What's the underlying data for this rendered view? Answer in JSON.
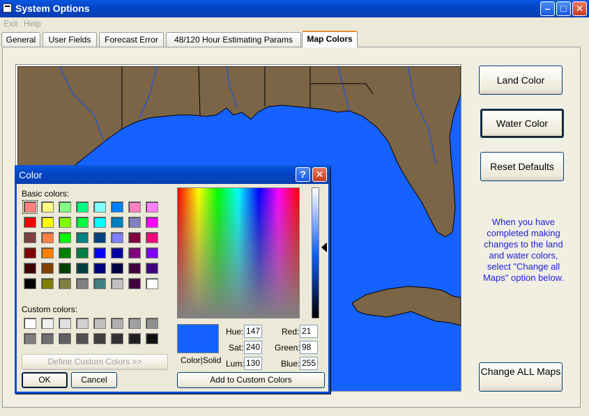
{
  "window": {
    "title": "System Options"
  },
  "menu": {
    "items": [
      "Exit",
      "Help"
    ]
  },
  "tabs": [
    {
      "label": "General"
    },
    {
      "label": "User Fields"
    },
    {
      "label": "Forecast Error"
    },
    {
      "label": "48/120 Hour Estimating Params"
    },
    {
      "label": "Map Colors",
      "active": true
    }
  ],
  "buttons": {
    "land": {
      "label": "Land Color",
      "accel": "L"
    },
    "water": {
      "label": "Water Color",
      "accel": "W"
    },
    "reset": {
      "label": "Reset Defaults",
      "accel": "R"
    },
    "change_all": {
      "label": "Change ALL Maps"
    }
  },
  "info_text": "When you have completed making changes to the land and water colors, select \"Change all Maps\" option below.",
  "map_colors": {
    "land": "#7c6447",
    "water": "#1562ff"
  },
  "color_dialog": {
    "title": "Color",
    "basic_colors_label": "Basic colors:",
    "custom_colors_label": "Custom colors:",
    "basic_colors": [
      [
        "#ff8080",
        "#ffff80",
        "#80ff80",
        "#00ff80",
        "#80ffff",
        "#0080ff",
        "#ff80c0",
        "#ff80ff"
      ],
      [
        "#ff0000",
        "#ffff00",
        "#80ff00",
        "#00ff40",
        "#00ffff",
        "#0080c0",
        "#8080c0",
        "#ff00ff"
      ],
      [
        "#804040",
        "#ff8040",
        "#00ff00",
        "#008080",
        "#004080",
        "#8080ff",
        "#800040",
        "#ff0080"
      ],
      [
        "#800000",
        "#ff8000",
        "#008000",
        "#008040",
        "#0000ff",
        "#0000a0",
        "#800080",
        "#8000ff"
      ],
      [
        "#400000",
        "#804000",
        "#004000",
        "#004040",
        "#000080",
        "#000040",
        "#400040",
        "#400080"
      ],
      [
        "#000000",
        "#808000",
        "#808040",
        "#808080",
        "#408080",
        "#c0c0c0",
        "#400040",
        "#ffffff"
      ]
    ],
    "custom_colors": [
      [
        "#ffffff",
        "#f0f0f0",
        "#e0e0e0",
        "#d0d0d0",
        "#c0c0c0",
        "#b0b0b0",
        "#a0a0a0",
        "#909090"
      ],
      [
        "#808080",
        "#707070",
        "#606060",
        "#505050",
        "#404040",
        "#303030",
        "#202020",
        "#101010"
      ]
    ],
    "define_custom_label": "Define Custom Colors >>",
    "ok_label": "OK",
    "cancel_label": "Cancel",
    "color_solid_label": "Color|Solid",
    "add_custom_label": "Add to Custom Colors",
    "hue_label": "Hue:",
    "hue": "147",
    "sat_label": "Sat:",
    "sat": "240",
    "lum_label": "Lum:",
    "lum": "130",
    "red_label": "Red:",
    "red": "21",
    "green_label": "Green:",
    "green": "98",
    "blue_label": "Blue:",
    "blue": "255",
    "current_color": "#1562ff"
  }
}
